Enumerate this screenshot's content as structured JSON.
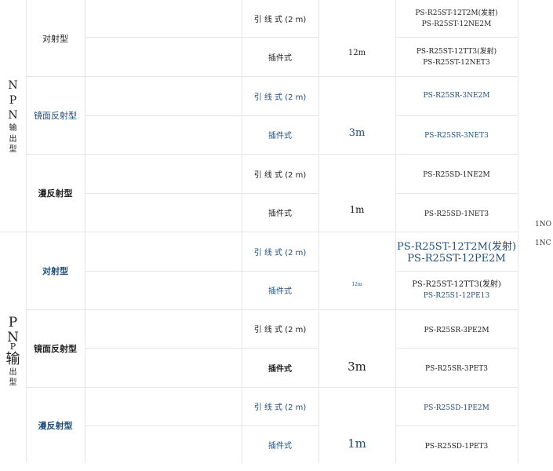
{
  "npn": {
    "label_chars": [
      "N",
      "P",
      "N",
      "输",
      "出",
      "型"
    ],
    "groups": [
      {
        "type": "对射型",
        "rows": [
          {
            "wiring": "引 线 式 (2 m)",
            "models": [
              "PS-R25ST-12T2M(发射)",
              "PS-R25ST-12NE2M"
            ]
          },
          {
            "wiring": "插件式",
            "models": [
              "PS-R25ST-12TT3(发射)",
              "PS-R25ST-12NET3"
            ]
          }
        ],
        "distance": "12m"
      },
      {
        "type": "镜面反射型",
        "rows": [
          {
            "wiring": "引 线 式 (2 m)",
            "models": [
              "PS-R25SR-3NE2M"
            ]
          },
          {
            "wiring": "插件式",
            "models": [
              "PS-R25SR-3NET3"
            ]
          }
        ],
        "distance": "3m"
      },
      {
        "type": "漫反射型",
        "rows": [
          {
            "wiring": "引 线 式 (2 m)",
            "models": [
              "PS-R25SD-1NE2M"
            ]
          },
          {
            "wiring": "插件式",
            "models": [
              "PS-R25SD-1NET3"
            ]
          }
        ],
        "distance": "1m"
      }
    ]
  },
  "pnp": {
    "label_chars": [
      "P",
      "N",
      "P",
      "输",
      "出",
      "型"
    ],
    "groups": [
      {
        "type": "对射型",
        "rows": [
          {
            "wiring": "引 线 式 (2 m)",
            "models": [
              "PS-R25ST-12T2M(发射)",
              "PS-R25ST-12PE2M"
            ]
          },
          {
            "wiring": "插件式",
            "models": [
              "PS-R25ST-12TT3(发射)",
              "PS-R25S1-12PE13"
            ]
          }
        ],
        "distance": "12m"
      },
      {
        "type": "镜面反射型",
        "rows": [
          {
            "wiring": "引 线 式 (2 m)",
            "models": [
              "PS-R25SR-3PE2M"
            ]
          },
          {
            "wiring": "插件式",
            "models": [
              "PS-R25SR-3PET3"
            ]
          }
        ],
        "distance": "3m"
      },
      {
        "type": "漫反射型",
        "rows": [
          {
            "wiring": "引 线 式 (2 m)",
            "models": [
              "PS-R25SD-1PE2M"
            ]
          },
          {
            "wiring": "插件式",
            "models": [
              "PS-R25SD-1PET3"
            ]
          }
        ],
        "distance": "1m"
      }
    ]
  },
  "side_labels": [
    "1NO",
    "1NC"
  ],
  "colors": {
    "accent": "#1f4e79",
    "grid": "#e6e6e6"
  }
}
